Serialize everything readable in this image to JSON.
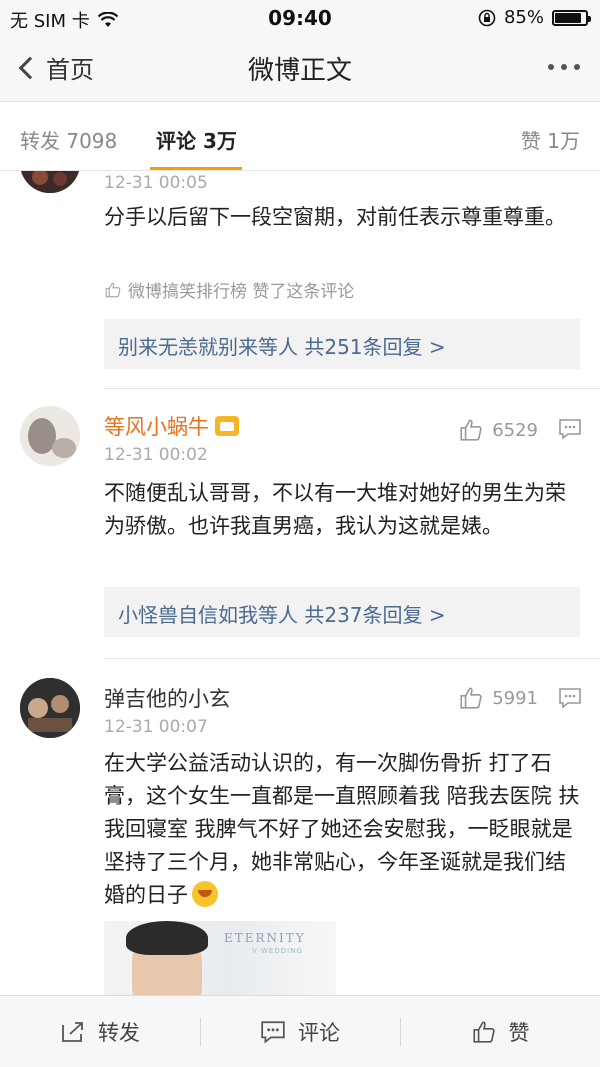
{
  "status_bar": {
    "carrier": "无 SIM 卡",
    "time": "09:40",
    "battery": "85%",
    "battery_level": 0.85
  },
  "nav": {
    "back_label": "首页",
    "title": "微博正文"
  },
  "tabs": {
    "repost": "转发 7098",
    "comment": "评论 3万",
    "like": "赞 1万"
  },
  "comments": [
    {
      "time": "12-31 00:05",
      "text": "分手以后留下一段空窗期，对前任表示尊重尊重。",
      "liked_by": "微博搞笑排行榜 赞了这条评论",
      "replies": "别来无恙就别来等人  共251条回复 >"
    },
    {
      "user": "等风小蜗牛",
      "time": "12-31 00:02",
      "likes": "6529",
      "text": "不随便乱认哥哥，不以有一大堆对她好的男生为荣为骄傲。也许我直男癌，我认为这就是婊。",
      "replies": "小怪兽自信如我等人  共237条回复 >"
    },
    {
      "user": "弹吉他的小玄",
      "time": "12-31 00:07",
      "likes": "5991",
      "text": "在大学公益活动认识的，有一次脚伤骨折 打了石膏，这个女生一直都是一直照顾着我 陪我去医院 扶我回寝室 我脾气不好了她还会安慰我，一眨眼就是坚持了三个月，她非常贴心，今年圣诞就是我们结婚的日子",
      "image_brand": "ETERNITY",
      "image_brand_sub": "V·WEDDING"
    }
  ],
  "toolbar": {
    "repost": "转发",
    "comment": "评论",
    "like": "赞"
  },
  "colors": {
    "accent_orange": "#f5a000",
    "username_orange": "#e8711a",
    "reply_link": "#4a6a90"
  }
}
